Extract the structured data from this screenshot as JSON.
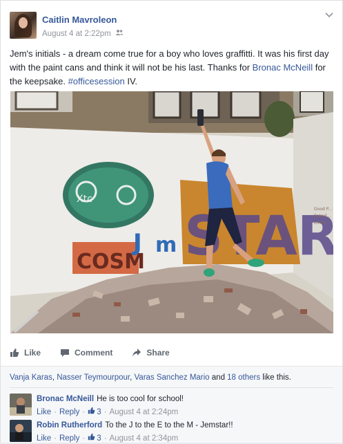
{
  "post": {
    "author": "Caitlin Mavroleon",
    "date": "August 4 at 2:22pm",
    "text_before": "Jem's initials - a dream come true for a boy who loves graffitti. It was his first day with the paint cans and think it will not be his last. Thanks for ",
    "mention": "Bronac McNeill",
    "text_middle": " for the keepsake. ",
    "hashtag": "#officesession",
    "text_after": " IV."
  },
  "actions": {
    "like": "Like",
    "comment": "Comment",
    "share": "Share"
  },
  "likes": {
    "names": [
      "Vanja Karas",
      "Nasser Teymourpour",
      "Varas Sanchez Mario"
    ],
    "others": "18 others",
    "suffix": " like this.",
    "sep1": ", ",
    "sep2": ", ",
    "and": " and "
  },
  "comments": [
    {
      "name": "Bronac McNeill",
      "text": "He is too cool for school!",
      "like": "Like",
      "reply": "Reply",
      "count": "3",
      "date": "August 4 at 2:24pm"
    },
    {
      "name": "Robin Rutherford",
      "text": "To the J to the E to the M - Jemstar!!",
      "like": "Like",
      "reply": "Reply",
      "count": "3",
      "date": "August 4 at 2:34pm"
    }
  ],
  "colors": {
    "link": "#365899",
    "muted": "#90949c"
  }
}
